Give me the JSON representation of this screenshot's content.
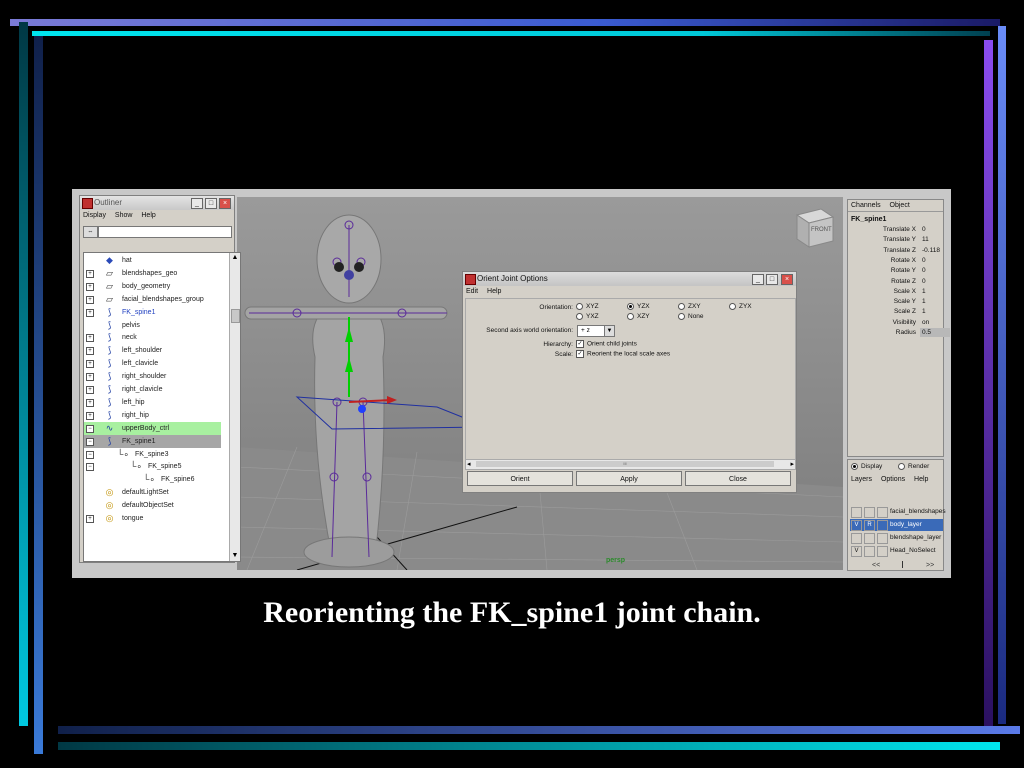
{
  "caption": "Reorienting the FK_spine1 joint chain.",
  "outliner": {
    "title": "Outliner",
    "menu": [
      "Display",
      "Show",
      "Help"
    ],
    "items": [
      {
        "label": "hat",
        "icon": "mesh-icon",
        "expand": ""
      },
      {
        "label": "blendshapes_geo",
        "icon": "transform-icon",
        "expand": "⊞"
      },
      {
        "label": "body_geometry",
        "icon": "transform-icon",
        "expand": "⊞"
      },
      {
        "label": "facial_blendshapes_group",
        "icon": "transform-icon",
        "expand": "⊞"
      },
      {
        "label": "FK_spine1",
        "icon": "joint-icon",
        "expand": "⊞"
      },
      {
        "label": "pelvis",
        "icon": "joint-icon",
        "expand": ""
      },
      {
        "label": "neck",
        "icon": "joint-icon",
        "expand": "⊞"
      },
      {
        "label": "left_shoulder",
        "icon": "joint-icon",
        "expand": "⊞"
      },
      {
        "label": "left_clavicle",
        "icon": "joint-icon",
        "expand": "⊞"
      },
      {
        "label": "right_shoulder",
        "icon": "joint-icon",
        "expand": "⊞"
      },
      {
        "label": "right_clavicle",
        "icon": "joint-icon",
        "expand": "⊞"
      },
      {
        "label": "left_hip",
        "icon": "joint-icon",
        "expand": "⊞"
      },
      {
        "label": "right_hip",
        "icon": "joint-icon",
        "expand": "⊞"
      },
      {
        "label": "upperBody_ctrl",
        "icon": "curve-icon",
        "expand": "⊟"
      },
      {
        "label": "FK_spine1",
        "icon": "joint-icon",
        "expand": "⊟"
      },
      {
        "label": "FK_spine3",
        "icon": "",
        "expand": "⊟"
      },
      {
        "label": "FK_spine5",
        "icon": "",
        "expand": "⊟"
      },
      {
        "label": "FK_spine6",
        "icon": "",
        "expand": ""
      },
      {
        "label": "defaultLightSet",
        "icon": "set-icon",
        "expand": ""
      },
      {
        "label": "defaultObjectSet",
        "icon": "set-icon",
        "expand": ""
      },
      {
        "label": "tongue",
        "icon": "set-icon",
        "expand": "⊞"
      }
    ]
  },
  "viewport": {
    "camera_label": "persp",
    "viewcube_label": "FRONT"
  },
  "dialog": {
    "title": "Orient Joint Options",
    "menu": [
      "Edit",
      "Help"
    ],
    "orientation_label": "Orientation:",
    "orientation_options": [
      "XYZ",
      "YZX",
      "ZXY",
      "ZYX",
      "YXZ",
      "XZY",
      "None"
    ],
    "orientation_selected": "YZX",
    "second_axis_label": "Second axis world orientation:",
    "second_axis_value": "+ z",
    "hierarchy_label": "Hierarchy:",
    "hierarchy_check": "Orient child joints",
    "scale_label": "Scale:",
    "scale_check": "Reorient the local scale axes",
    "scroll_marker": "III",
    "buttons": [
      "Orient",
      "Apply",
      "Close"
    ]
  },
  "channel_box": {
    "menu": [
      "Channels",
      "Object"
    ],
    "node": "FK_spine1",
    "attributes": [
      {
        "name": "Translate X",
        "value": "0"
      },
      {
        "name": "Translate Y",
        "value": "11"
      },
      {
        "name": "Translate Z",
        "value": "-0.118"
      },
      {
        "name": "Rotate X",
        "value": "0"
      },
      {
        "name": "Rotate Y",
        "value": "0"
      },
      {
        "name": "Rotate Z",
        "value": "0"
      },
      {
        "name": "Scale X",
        "value": "1"
      },
      {
        "name": "Scale Y",
        "value": "1"
      },
      {
        "name": "Scale Z",
        "value": "1"
      },
      {
        "name": "Visibility",
        "value": "on"
      },
      {
        "name": "Radius",
        "value": "0.5"
      }
    ]
  },
  "layer_editor": {
    "tabs": [
      "Display",
      "Render"
    ],
    "menu": [
      "Layers",
      "Options",
      "Help"
    ],
    "layers": [
      {
        "v": "",
        "r": "",
        "name": "facial_blendshapes"
      },
      {
        "v": "V",
        "r": "R",
        "name": "body_layer"
      },
      {
        "v": "",
        "r": "",
        "name": "blendshape_layer"
      },
      {
        "v": "V",
        "r": "",
        "name": "Head_NoSelect"
      }
    ],
    "nav_left": "<<",
    "nav_right": ">>"
  },
  "colors": {
    "highlight_green": "#a8f0a0",
    "highlight_gray": "#a6a6a6",
    "selected_layer": "#3a6ab8",
    "accent_cyan": "#00e5ee",
    "accent_blue": "#4a6cf0",
    "accent_purple": "#8a4cf0"
  }
}
